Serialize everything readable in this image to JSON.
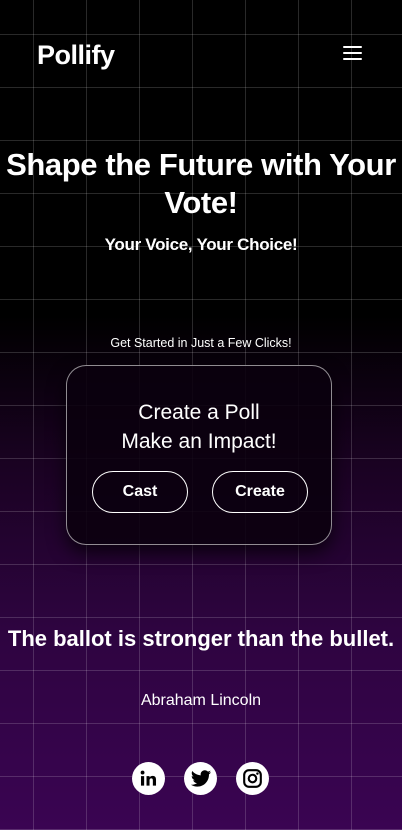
{
  "header": {
    "logo": "Pollify",
    "menu_icon": "hamburger-menu-icon"
  },
  "hero": {
    "title": "Shape the Future with Your Vote!",
    "subtitle": "Your Voice, Your Choice!"
  },
  "cta": {
    "tagline": "Get Started in Just a Few Clicks!",
    "card_line1": "Create a Poll",
    "card_line2": "Make an Impact!",
    "cast_label": "Cast",
    "create_label": "Create"
  },
  "quote": {
    "text": "The ballot is stronger than the bullet.",
    "author": "Abraham Lincoln"
  },
  "social": [
    {
      "icon": "linkedin-icon"
    },
    {
      "icon": "twitter-icon"
    },
    {
      "icon": "instagram-icon"
    }
  ],
  "colors": {
    "background_top": "#000000",
    "background_bottom": "#3a0452",
    "text": "#ffffff"
  }
}
